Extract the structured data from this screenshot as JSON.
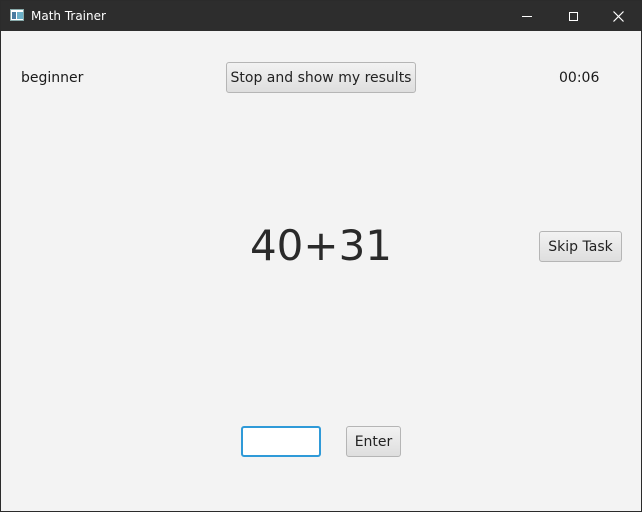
{
  "window": {
    "title": "Math Trainer",
    "icon": "app-window-icon",
    "controls": [
      "minimize-icon",
      "maximize-icon",
      "close-icon"
    ]
  },
  "header": {
    "level": "beginner",
    "stop_button_label": "Stop and show my results",
    "timer": "00:06"
  },
  "task": {
    "expression": "40+31",
    "skip_button_label": "Skip Task"
  },
  "answer": {
    "value": "",
    "placeholder": "",
    "enter_button_label": "Enter"
  },
  "colors": {
    "titlebar": "#2d2d2d",
    "background": "#f3f3f3",
    "input_focus": "#2f9ad8"
  }
}
